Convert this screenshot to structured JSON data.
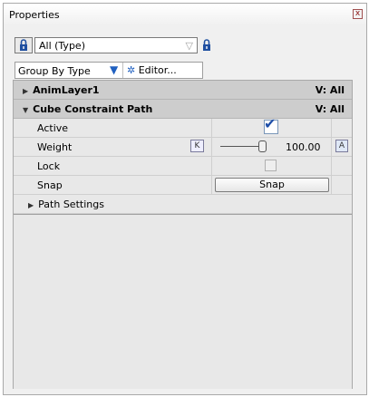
{
  "window": {
    "title": "Properties",
    "close_label": "x"
  },
  "toolbar": {
    "type_filter_value": "All (Type)",
    "group_by_label": "Group By Type",
    "editor_label": "Editor..."
  },
  "groups": [
    {
      "name": "AnimLayer1",
      "visibility": "V: All",
      "expanded": false
    },
    {
      "name": "Cube Constraint Path",
      "visibility": "V: All",
      "expanded": true
    }
  ],
  "properties": {
    "active": {
      "label": "Active",
      "checked": true
    },
    "weight": {
      "label": "Weight",
      "key_label": "K",
      "value": "100.00",
      "anim_label": "A"
    },
    "lock": {
      "label": "Lock",
      "checked": false
    },
    "snap": {
      "label": "Snap",
      "button_label": "Snap"
    },
    "path_settings": {
      "label": "Path Settings",
      "expanded": false
    }
  },
  "colors": {
    "accent": "#2060c0",
    "header_bg": "#cdcdcd",
    "panel_bg": "#f0f0f0"
  }
}
